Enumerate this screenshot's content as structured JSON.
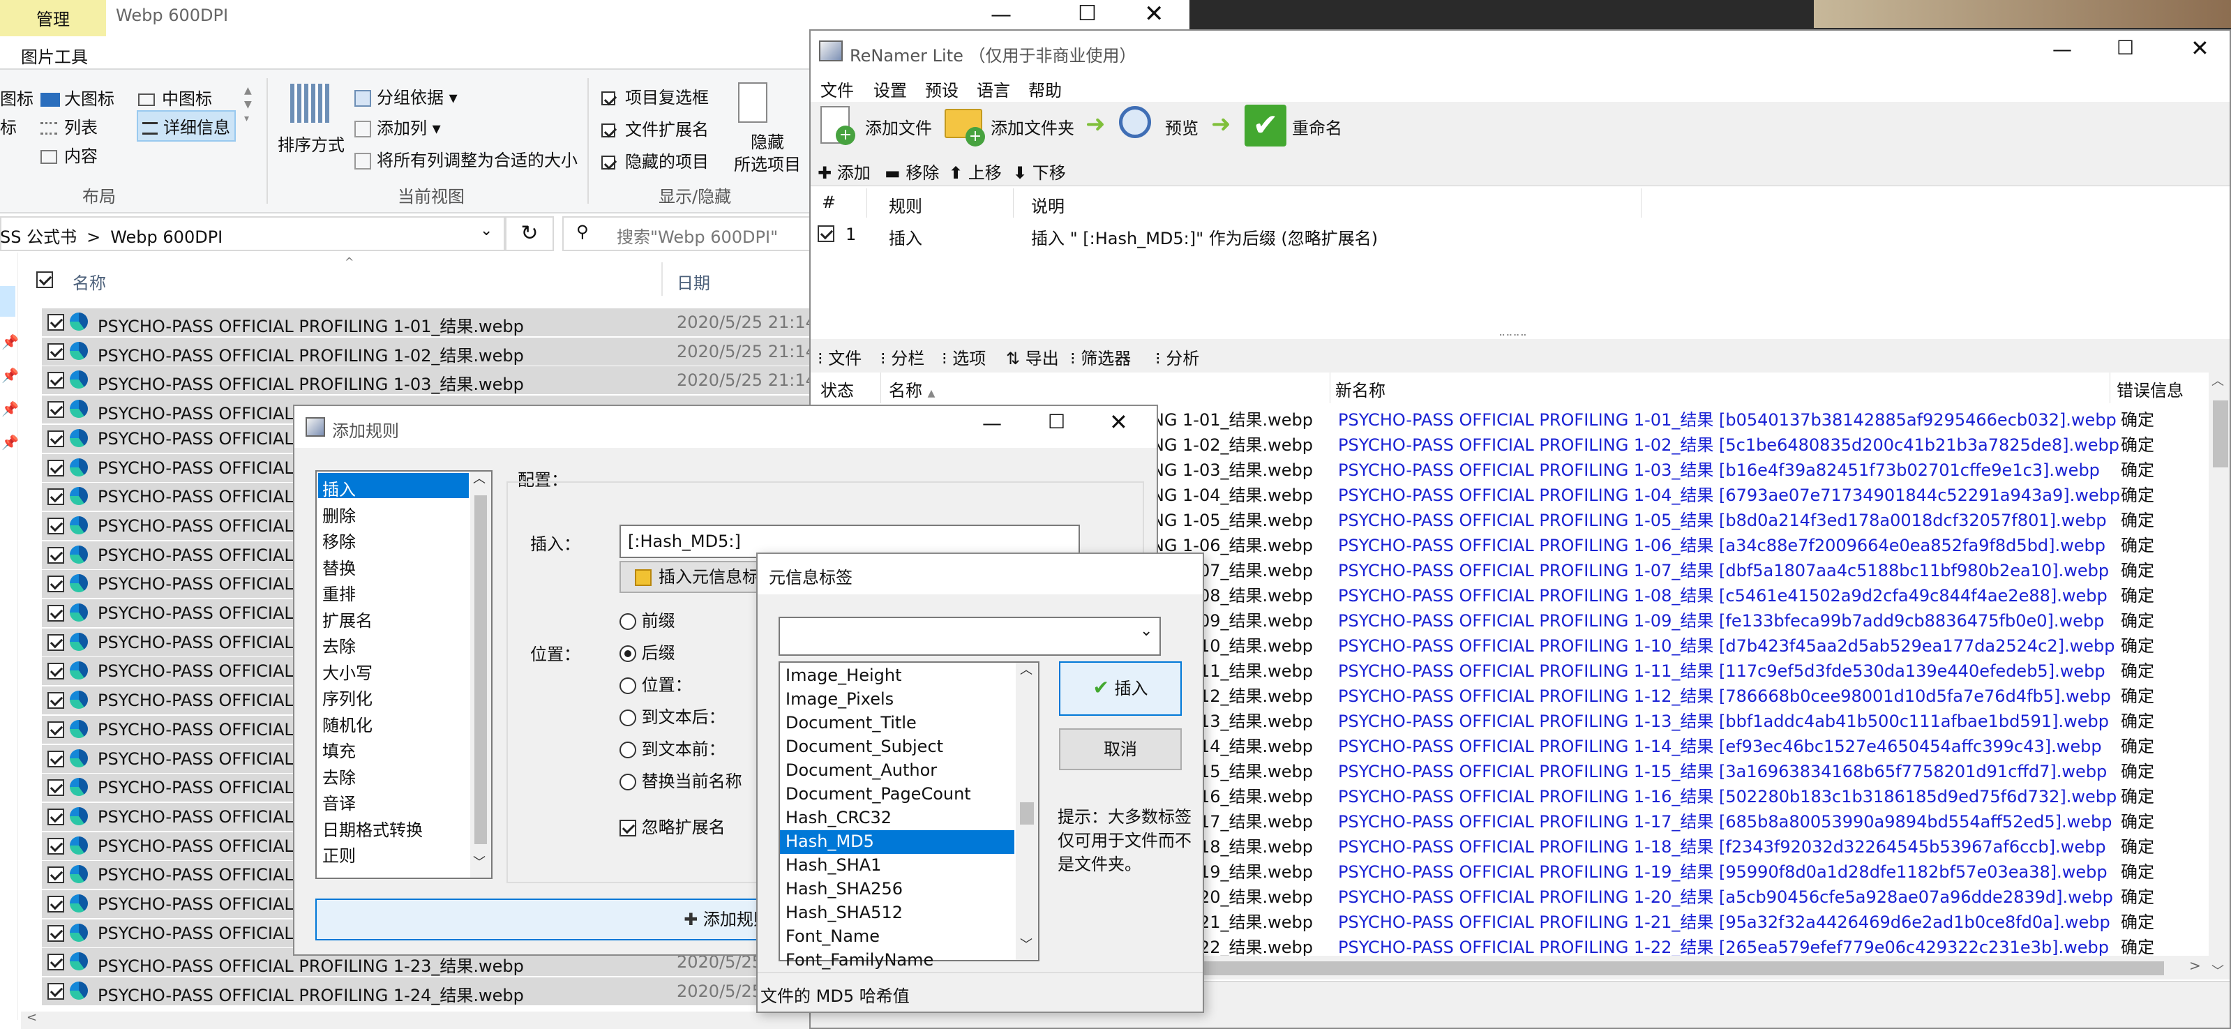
{
  "explorer": {
    "ribbon_tab_manage": "管理",
    "ribbon_tab_picture": "图片工具",
    "window_title": "Webp 600DPI",
    "layout": {
      "icons_small": "图标",
      "large_icons": "大图标",
      "medium_icons": "中图标",
      "list_small": "标",
      "list": "列表",
      "details": "详细信息",
      "content": "内容",
      "group_label": "布局"
    },
    "current_view": {
      "sort": "排序方式",
      "group_by": "分组依据",
      "add_column": "添加列",
      "fit_columns": "将所有列调整为合适的大小",
      "group_label": "当前视图"
    },
    "show_hide": {
      "item_checkbox": "项目复选框",
      "file_ext": "文件扩展名",
      "hidden_items": "隐藏的项目",
      "hide_selected_1": "隐藏",
      "hide_selected_2": "所选项目",
      "group_label": "显示/隐藏"
    },
    "breadcrumb_parent": "SS 公式书",
    "breadcrumb_current": "Webp 600DPI",
    "search_placeholder": "搜索\"Webp 600DPI\"",
    "col_name": "名称",
    "col_date": "日期",
    "files": [
      {
        "name": "PSYCHO-PASS OFFICIAL PROFILING 1-01_结果.webp",
        "date": "2020/5/25 21:14"
      },
      {
        "name": "PSYCHO-PASS OFFICIAL PROFILING 1-02_结果.webp",
        "date": "2020/5/25 21:14"
      },
      {
        "name": "PSYCHO-PASS OFFICIAL PROFILING 1-03_结果.webp",
        "date": "2020/5/25 21:14"
      },
      {
        "name": "PSYCHO-PASS OFFICIAL PROFILING 1-04_结果.webp",
        "date": ""
      },
      {
        "name": "PSYCHO-PASS OFFICIAL",
        "date": ""
      },
      {
        "name": "PSYCHO-PASS OFFICIAL",
        "date": ""
      },
      {
        "name": "PSYCHO-PASS OFFICIAL",
        "date": ""
      },
      {
        "name": "PSYCHO-PASS OFFICIAL",
        "date": ""
      },
      {
        "name": "PSYCHO-PASS OFFICIAL",
        "date": ""
      },
      {
        "name": "PSYCHO-PASS OFFICIAL",
        "date": ""
      },
      {
        "name": "PSYCHO-PASS OFFICIAL",
        "date": ""
      },
      {
        "name": "PSYCHO-PASS OFFICIAL",
        "date": ""
      },
      {
        "name": "PSYCHO-PASS OFFICIAL",
        "date": ""
      },
      {
        "name": "PSYCHO-PASS OFFICIAL",
        "date": ""
      },
      {
        "name": "PSYCHO-PASS OFFICIAL",
        "date": ""
      },
      {
        "name": "PSYCHO-PASS OFFICIAL",
        "date": ""
      },
      {
        "name": "PSYCHO-PASS OFFICIAL",
        "date": ""
      },
      {
        "name": "PSYCHO-PASS OFFICIAL",
        "date": ""
      },
      {
        "name": "PSYCHO-PASS OFFICIAL",
        "date": ""
      },
      {
        "name": "PSYCHO-PASS OFFICIAL",
        "date": ""
      },
      {
        "name": "PSYCHO-PASS OFFICIAL",
        "date": ""
      },
      {
        "name": "PSYCHO-PASS OFFICIAL",
        "date": ""
      },
      {
        "name": "PSYCHO-PASS OFFICIAL PROFILING 1-23_结果.webp",
        "date": "2020/5/25"
      },
      {
        "name": "PSYCHO-PASS OFFICIAL PROFILING 1-24_结果.webp",
        "date": "2020/5/25"
      }
    ]
  },
  "renamer": {
    "title": "ReNamer Lite （仅用于非商业使用）",
    "menu": [
      "文件",
      "设置",
      "预设",
      "语言",
      "帮助"
    ],
    "toolbar": {
      "add_files": "添加文件",
      "add_folders": "添加文件夹",
      "preview": "预览",
      "rename": "重命名"
    },
    "rule_toolbar": {
      "add": "添加",
      "remove": "移除",
      "up": "上移",
      "down": "下移"
    },
    "rules_header": {
      "num": "#",
      "rule": "规则",
      "desc": "说明"
    },
    "rules": [
      {
        "num": "1",
        "rule": "插入",
        "desc": "插入 \" [:Hash_MD5:]\" 作为后缀 (忽略扩展名)"
      }
    ],
    "files_toolbar": {
      "files": "文件",
      "columns": "分栏",
      "options": "选项",
      "export": "导出",
      "filter": "筛选器",
      "analyze": "分析"
    },
    "files_header": {
      "status": "状态",
      "name": "名称",
      "new_name": "新名称",
      "error": "错误信息"
    },
    "files": [
      {
        "old": "NG 1-01_结果.webp",
        "new": "PSYCHO-PASS OFFICIAL PROFILING 1-01_结果 [b0540137b38142885af9295466ecb032].webp",
        "err": "确定"
      },
      {
        "old": "NG 1-02_结果.webp",
        "new": "PSYCHO-PASS OFFICIAL PROFILING 1-02_结果 [5c1be6480835d200c41b21b3a7825de8].webp",
        "err": "确定"
      },
      {
        "old": "NG 1-03_结果.webp",
        "new": "PSYCHO-PASS OFFICIAL PROFILING 1-03_结果 [b16e4f39a82451f73b02701cffe9e1c3].webp",
        "err": "确定"
      },
      {
        "old": "NG 1-04_结果.webp",
        "new": "PSYCHO-PASS OFFICIAL PROFILING 1-04_结果 [6793ae07e71734901844c52291a943a9].webp",
        "err": "确定"
      },
      {
        "old": "NG 1-05_结果.webp",
        "new": "PSYCHO-PASS OFFICIAL PROFILING 1-05_结果 [b8d0a214f3ed178a0018dcf32057f801].webp",
        "err": "确定"
      },
      {
        "old": "NG 1-06_结果.webp",
        "new": "PSYCHO-PASS OFFICIAL PROFILING 1-06_结果 [a34c88e7f2009664e0ea852fa9f8d5bd].webp",
        "err": "确定"
      },
      {
        "old": "07_结果.webp",
        "new": "PSYCHO-PASS OFFICIAL PROFILING 1-07_结果 [dbf5a1807aa4c5188bc11bf980b2ea10].webp",
        "err": "确定"
      },
      {
        "old": "08_结果.webp",
        "new": "PSYCHO-PASS OFFICIAL PROFILING 1-08_结果 [c5461e41502a9d2cfa49c844f4ae2e88].webp",
        "err": "确定"
      },
      {
        "old": "09_结果.webp",
        "new": "PSYCHO-PASS OFFICIAL PROFILING 1-09_结果 [fe133bfeca99b7add9cb8836475fb0e0].webp",
        "err": "确定"
      },
      {
        "old": "10_结果.webp",
        "new": "PSYCHO-PASS OFFICIAL PROFILING 1-10_结果 [d7b423f45aa2d5ab529ea177da2524c2].webp",
        "err": "确定"
      },
      {
        "old": "11_结果.webp",
        "new": "PSYCHO-PASS OFFICIAL PROFILING 1-11_结果 [117c9ef5d3fde530da139e440efedeb5].webp",
        "err": "确定"
      },
      {
        "old": "12_结果.webp",
        "new": "PSYCHO-PASS OFFICIAL PROFILING 1-12_结果 [786668b0cee98001d10d5fa7e76d4fb5].webp",
        "err": "确定"
      },
      {
        "old": "13_结果.webp",
        "new": "PSYCHO-PASS OFFICIAL PROFILING 1-13_结果 [bbf1addc4ab41b500c111afbae1bd591].webp",
        "err": "确定"
      },
      {
        "old": "14_结果.webp",
        "new": "PSYCHO-PASS OFFICIAL PROFILING 1-14_结果 [ef93ec46bc1527e4650454affc399c43].webp",
        "err": "确定"
      },
      {
        "old": "15_结果.webp",
        "new": "PSYCHO-PASS OFFICIAL PROFILING 1-15_结果 [3a16963834168b65f7758201d91cffd7].webp",
        "err": "确定"
      },
      {
        "old": "16_结果.webp",
        "new": "PSYCHO-PASS OFFICIAL PROFILING 1-16_结果 [502280b183c1b3186185d9ed75f6d732].webp",
        "err": "确定"
      },
      {
        "old": "17_结果.webp",
        "new": "PSYCHO-PASS OFFICIAL PROFILING 1-17_结果 [685b8a80053990a9894bd554aff52ed5].webp",
        "err": "确定"
      },
      {
        "old": "18_结果.webp",
        "new": "PSYCHO-PASS OFFICIAL PROFILING 1-18_结果 [f2343f92032d32264545b53967af6ccb].webp",
        "err": "确定"
      },
      {
        "old": "19_结果.webp",
        "new": "PSYCHO-PASS OFFICIAL PROFILING 1-19_结果 [95990f8d0a1d28dfe1182bf57e03ea38].webp",
        "err": "确定"
      },
      {
        "old": "20_结果.webp",
        "new": "PSYCHO-PASS OFFICIAL PROFILING 1-20_结果 [a5cb90456cfe5a928ae07a96dde2839d].webp",
        "err": "确定"
      },
      {
        "old": "21_结果.webp",
        "new": "PSYCHO-PASS OFFICIAL PROFILING 1-21_结果 [95a32f32a4426469d6e2ad1b0ce8fd0a].webp",
        "err": "确定"
      },
      {
        "old": "22_结果.webp",
        "new": "PSYCHO-PASS OFFICIAL PROFILING 1-22_结果 [265ea579efef779e06c429322c231e3b].webp",
        "err": "确定"
      }
    ]
  },
  "add_rule": {
    "title": "添加规则",
    "rules": [
      "插入",
      "删除",
      "移除",
      "替换",
      "重排",
      "扩展名",
      "去除",
      "大小写",
      "序列化",
      "随机化",
      "填充",
      "去除",
      "音译",
      "日期格式转换",
      "正则"
    ],
    "config_label": "配置：",
    "insert_label": "插入：",
    "insert_value": "[:Hash_MD5:]",
    "insert_meta_button": "插入元信息标签",
    "position_label": "位置：",
    "positions": {
      "prefix": "前缀",
      "suffix": "后缀",
      "position": "位置：",
      "after_text": "到文本后：",
      "before_text": "到文本前：",
      "replace_name": "替换当前名称"
    },
    "ignore_ext": "忽略扩展名",
    "add_rule_button": "添加规则"
  },
  "meta_dialog": {
    "title": "元信息标签",
    "tags": [
      "Image_Height",
      "Image_Pixels",
      "Document_Title",
      "Document_Subject",
      "Document_Author",
      "Document_PageCount",
      "Hash_CRC32",
      "Hash_MD5",
      "Hash_SHA1",
      "Hash_SHA256",
      "Hash_SHA512",
      "Font_Name",
      "Font_FamilyName"
    ],
    "insert_button": "插入",
    "cancel_button": "取消",
    "hint": [
      "提示：大多数标签",
      "仅可用于文件而不",
      "是文件夹。"
    ],
    "status": "文件的 MD5 哈希值"
  }
}
